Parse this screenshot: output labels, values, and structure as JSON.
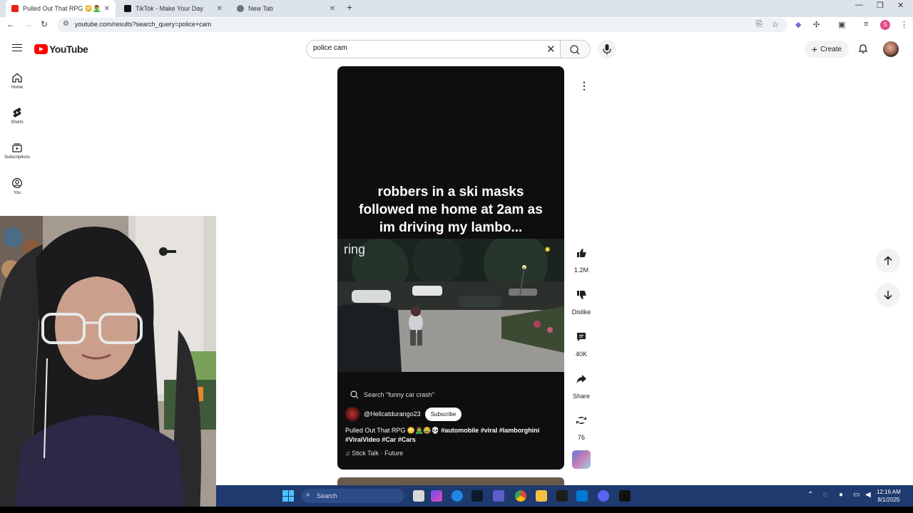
{
  "browser": {
    "tabs": [
      {
        "title": "Pulled Out That RPG 😳🧟‍♂️ ⟨ 🔊",
        "fav_color": "#e62117",
        "active": true
      },
      {
        "title": "TikTok - Make Your Day",
        "fav_color": "#111111",
        "active": false
      },
      {
        "title": "New Tab",
        "fav_color": "#6b7280",
        "active": false
      }
    ],
    "url": "youtube.com/results?search_query=police+cam",
    "profile_initial": "S"
  },
  "youtube": {
    "logo_text": "YouTube",
    "search_value": "police cam",
    "create_label": "Create",
    "nav": [
      {
        "label": "Home",
        "icon": "home-icon"
      },
      {
        "label": "Shorts",
        "icon": "shorts-icon"
      },
      {
        "label": "Subscriptions",
        "icon": "subscriptions-icon"
      },
      {
        "label": "You",
        "icon": "you-icon"
      }
    ]
  },
  "short": {
    "caption_lines": [
      "robbers in a ski masks",
      "followed me home at 2am as",
      "im driving my lambo..."
    ],
    "ring_logo": "ring",
    "search_hint": "Search \"funny car crash\"",
    "channel": "@Hellcatdurango23",
    "subscribe_label": "Subscribe",
    "title_plain": "Pulled Out That RPG 😳🧟‍♂️😂💀 ",
    "title_tags_1": "#automobile #viral #lamborghini",
    "title_tags_2": "#ViralVideo #Car #Cars",
    "music": "♫ Stick Talk · Future"
  },
  "actions": {
    "like_count": "1.2M",
    "dislike_label": "Dislike",
    "comment_count": "40K",
    "share_label": "Share",
    "remix_count": "76"
  },
  "taskbar": {
    "search_label": "Search",
    "time": "12:16 AM",
    "date": "8/1/2025",
    "accent": "#4cc2ff"
  }
}
